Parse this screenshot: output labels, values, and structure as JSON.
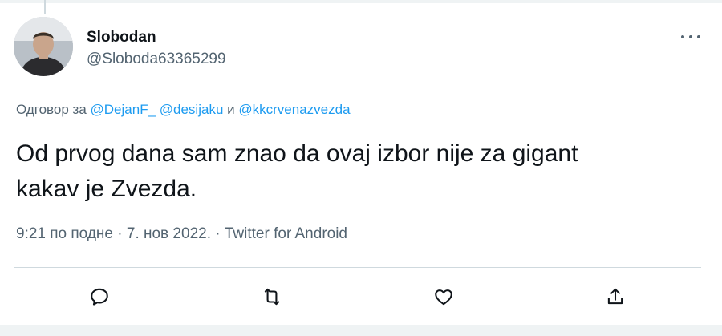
{
  "author": {
    "name": "Slobodan",
    "handle": "@Sloboda63365299",
    "avatar_icon": "user-photo"
  },
  "reply": {
    "prefix": "Одговор за",
    "mention_1": "@DejanF_",
    "mention_2": "@desijaku",
    "conjunction": "и",
    "mention_3": "@kkcrvenazvezda"
  },
  "tweet": {
    "line1": "Od prvog dana sam znao da ovaj izbor nije za gigant",
    "line2": "kakav je Zvezda."
  },
  "meta": {
    "time": "9:21 по подне",
    "separator": "·",
    "date": "7. нов 2022.",
    "source": "Twitter for Android"
  },
  "actions": [
    "reply-icon",
    "retweet-icon",
    "like-icon",
    "share-icon"
  ],
  "colors": {
    "text": "#0f1419",
    "secondary": "#536471",
    "link": "#1d9bf0",
    "divider": "#cfd9de"
  }
}
